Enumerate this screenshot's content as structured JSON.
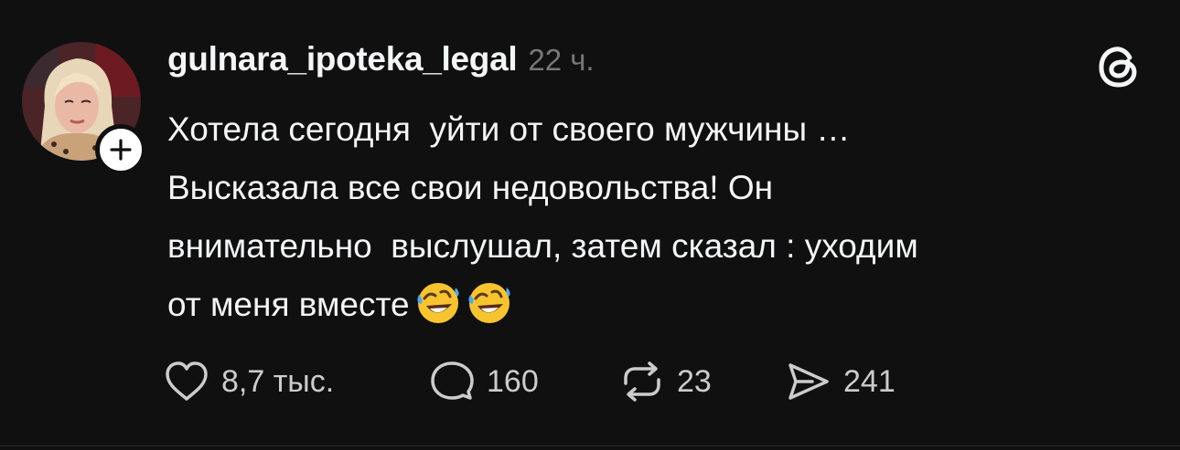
{
  "post": {
    "author": {
      "username": "gulnara_ipoteka_legal",
      "avatar_icon": "avatar-photo",
      "follow_icon": "plus-icon"
    },
    "timestamp": "22 ч.",
    "app_icon": "threads-logo-icon",
    "text_lines": [
      "Хотела сегодня  уйти от своего мужчины …",
      "Высказала все свои недовольства! Он",
      "внимательно  выслушал, затем сказал : уходим",
      "от меня вместе"
    ],
    "emojis": [
      "rolling-on-floor-laughing",
      "rolling-on-floor-laughing"
    ],
    "actions": {
      "likes": {
        "icon": "heart-icon",
        "count": "8,7 тыс."
      },
      "replies": {
        "icon": "comment-icon",
        "count": "160"
      },
      "reposts": {
        "icon": "repost-icon",
        "count": "23"
      },
      "shares": {
        "icon": "send-icon",
        "count": "241"
      }
    }
  },
  "colors": {
    "background": "#101010",
    "text": "#f3f5f7",
    "secondary_text": "#777777",
    "action_text": "#cccccc"
  }
}
